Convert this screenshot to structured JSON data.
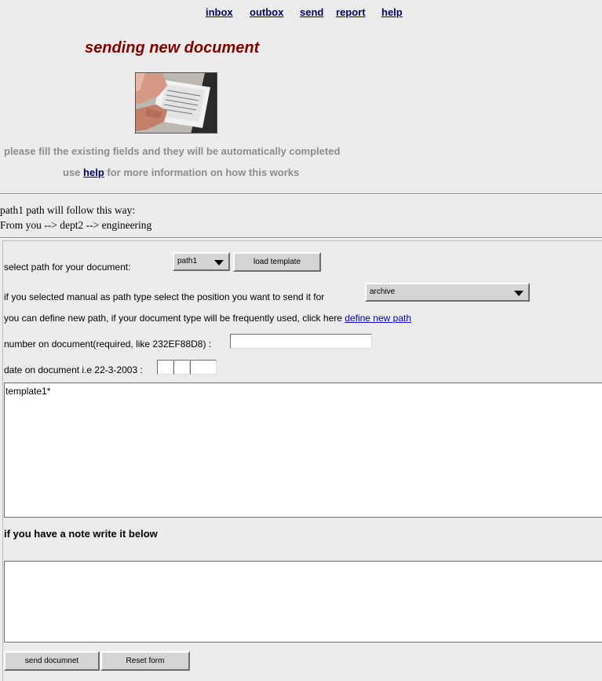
{
  "nav": {
    "inbox": "inbox",
    "outbox": "outbox",
    "send": "send",
    "report": "report",
    "help": "help"
  },
  "page": {
    "title": "sending new document"
  },
  "hints": {
    "fill": "please fill the existing fields and they will be automatically completed",
    "use": "use",
    "help_link": "help",
    "more": "for more information on how this works"
  },
  "path_info": {
    "line1": "path1 path will follow this way:",
    "line2": "From you --> dept2 --> engineering"
  },
  "form": {
    "select_path_label": "select path for your document:",
    "path_value": "path1",
    "load_template_label": "load template",
    "manual_label": "if you selected manual as path type select the position you want to send it for",
    "position_value": "archive",
    "define_text": "you can define new path, if your document type will be frequently used, click here",
    "define_link": "define new path",
    "number_label": "number on document(required, like 232EF88D8) :",
    "number_value": "",
    "date_label": "date on document i.e 22-3-2003 :",
    "date_day": "",
    "date_month": "",
    "date_year": "",
    "template_text": "template1*",
    "note_label": "if you have a note write it below",
    "note_text": "",
    "send_label": "send documnet",
    "reset_label": "Reset form"
  }
}
